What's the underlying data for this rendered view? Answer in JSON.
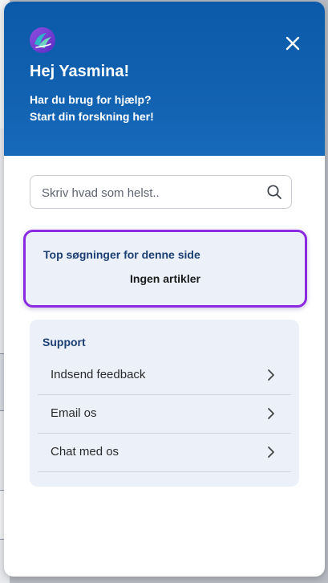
{
  "header": {
    "greeting": "Hej Yasmina!",
    "subtitle_line1": "Har du brug for hjælp?",
    "subtitle_line2": "Start din forskning her!"
  },
  "search": {
    "placeholder": "Skriv hvad som helst.."
  },
  "top_searches": {
    "title": "Top søgninger for denne side",
    "empty_text": "Ingen artikler"
  },
  "support": {
    "title": "Support",
    "items": [
      {
        "label": "Indsend feedback"
      },
      {
        "label": "Email os"
      },
      {
        "label": "Chat med os"
      }
    ]
  },
  "colors": {
    "header_blue": "#1160b0",
    "highlight_border": "#8a2be2",
    "section_title": "#1b3f74",
    "card_background": "#ecf0f8"
  },
  "icons": {
    "logo": "brand-logo-icon",
    "close": "close-icon",
    "search": "search-icon",
    "chevron": "chevron-right-icon"
  }
}
